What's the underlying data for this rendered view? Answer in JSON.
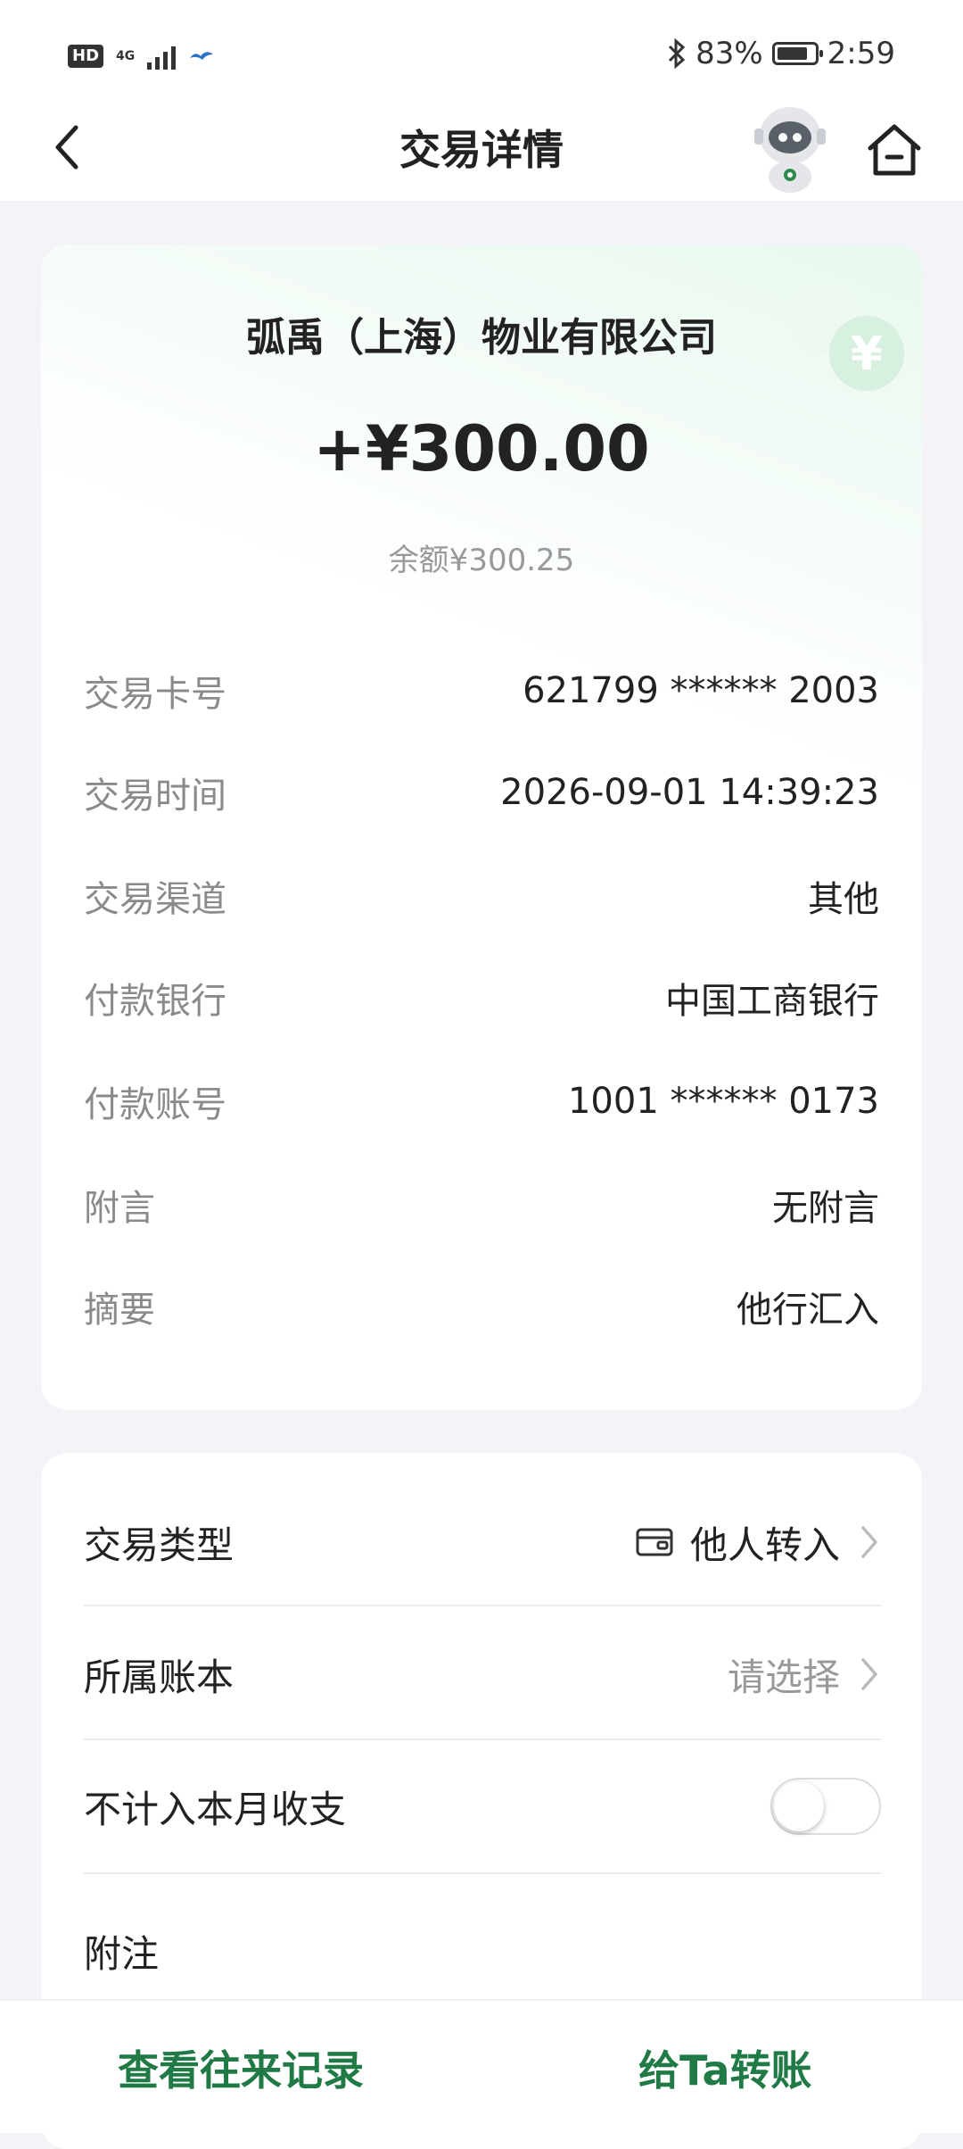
{
  "status_bar": {
    "hd": "HD",
    "network": "4G",
    "battery": "83%",
    "battery_level": 0.83,
    "time": "2:59"
  },
  "header": {
    "title": "交易详情",
    "back_icon": "chevron-left-icon",
    "assistant_icon": "robot-avatar-icon",
    "home_icon": "home-icon"
  },
  "transaction": {
    "counterparty": "弧禹（上海）物业有限公司",
    "amount": "+¥300.00",
    "balance": "余额¥300.25",
    "details": [
      {
        "label": "交易卡号",
        "value": "621799 ****** 2003"
      },
      {
        "label": "交易时间",
        "value": "2026-09-01 14:39:23"
      },
      {
        "label": "交易渠道",
        "value": "其他"
      },
      {
        "label": "付款银行",
        "value": "中国工商银行"
      },
      {
        "label": "付款账号",
        "value": "1001 ****** 0173"
      },
      {
        "label": "附言",
        "value": "无附言"
      },
      {
        "label": "摘要",
        "value": "他行汇入"
      }
    ]
  },
  "settings": {
    "type_label": "交易类型",
    "type_value": "他人转入",
    "type_icon": "wallet-transfer-icon",
    "ledger_label": "所属账本",
    "ledger_placeholder": "请选择",
    "exclude_label": "不计入本月收支",
    "exclude_on": false,
    "note_label": "附注"
  },
  "bottom_bar": {
    "history_label": "查看往来记录",
    "transfer_label": "给Ta转账"
  },
  "colors": {
    "accent": "#1f7a45",
    "background": "#f4f4f8",
    "muted": "#8a8a8a"
  }
}
